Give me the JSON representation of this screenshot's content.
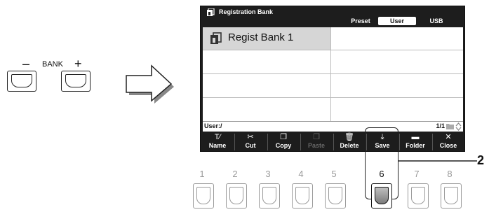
{
  "bank": {
    "label": "BANK",
    "minus": "–",
    "plus": "+"
  },
  "screen": {
    "title": "Registration Bank",
    "tabs": [
      {
        "label": "Preset",
        "active": false
      },
      {
        "label": "User",
        "active": true
      },
      {
        "label": "USB",
        "active": false
      }
    ],
    "files": [
      {
        "label": "Regist Bank 1",
        "selected": true
      }
    ],
    "path": "User:/",
    "page": "1/1",
    "functions": [
      {
        "icon": "name-icon",
        "glyph": "T⁄",
        "label": "Name",
        "enabled": true
      },
      {
        "icon": "cut-icon",
        "glyph": "✂",
        "label": "Cut",
        "enabled": true
      },
      {
        "icon": "copy-icon",
        "glyph": "❐",
        "label": "Copy",
        "enabled": true
      },
      {
        "icon": "paste-icon",
        "glyph": "❐",
        "label": "Paste",
        "enabled": false
      },
      {
        "icon": "delete-icon",
        "glyph": "🗑",
        "label": "Delete",
        "enabled": true
      },
      {
        "icon": "save-icon",
        "glyph": "⤓",
        "label": "Save",
        "enabled": true
      },
      {
        "icon": "folder-icon",
        "glyph": "▬",
        "label": "Folder",
        "enabled": true
      },
      {
        "icon": "close-icon",
        "glyph": "✕",
        "label": "Close",
        "enabled": true
      }
    ]
  },
  "buttons": [
    "1",
    "2",
    "3",
    "4",
    "5",
    "6",
    "7",
    "8"
  ],
  "active_button": "6",
  "callout": "2"
}
